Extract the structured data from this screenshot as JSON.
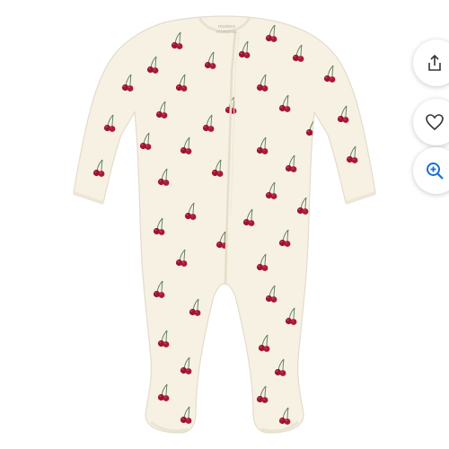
{
  "product": {
    "brand_tag_line1": "modern",
    "brand_tag_line2": "moments"
  },
  "actions": [
    {
      "name": "share",
      "icon": "share-icon"
    },
    {
      "name": "favorite",
      "icon": "heart-icon"
    },
    {
      "name": "zoom",
      "icon": "zoom-in-icon"
    }
  ],
  "colors": {
    "fabric": "#f6f1e3",
    "cherry": "#9b1530",
    "cherry_highlight": "#d2405a",
    "stem": "#5a7a55",
    "zoom_accent": "#1a6fd1",
    "icon_dark": "#333333"
  }
}
